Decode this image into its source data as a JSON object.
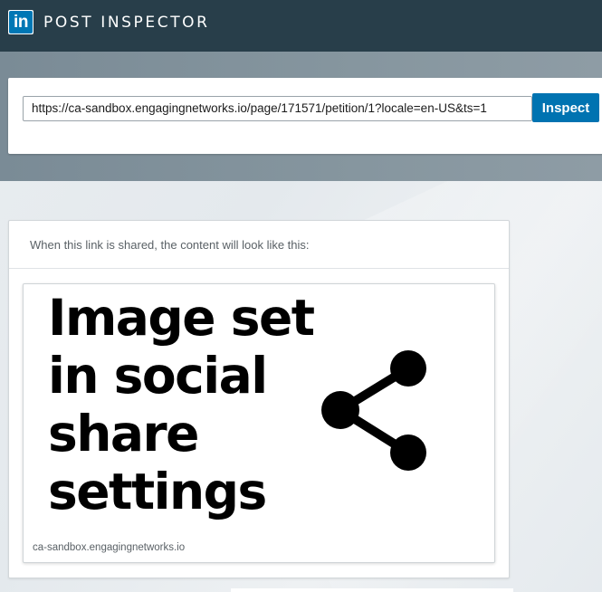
{
  "header": {
    "logo_text": "in",
    "title": "POST INSPECTOR",
    "bar_color": "#283e4a",
    "logo_color": "#0077b5"
  },
  "inspect": {
    "url_value": "https://ca-sandbox.engagingnetworks.io/page/171571/petition/1?locale=en-US&ts=1",
    "button_label": "Inspect",
    "button_color": "#0073b1"
  },
  "preview": {
    "header_text": "When this link is shared, the content will look like this:",
    "image_text": "Image set\nin social\nshare\nsettings",
    "image_icon": "share-icon",
    "domain": "ca-sandbox.engagingnetworks.io"
  }
}
